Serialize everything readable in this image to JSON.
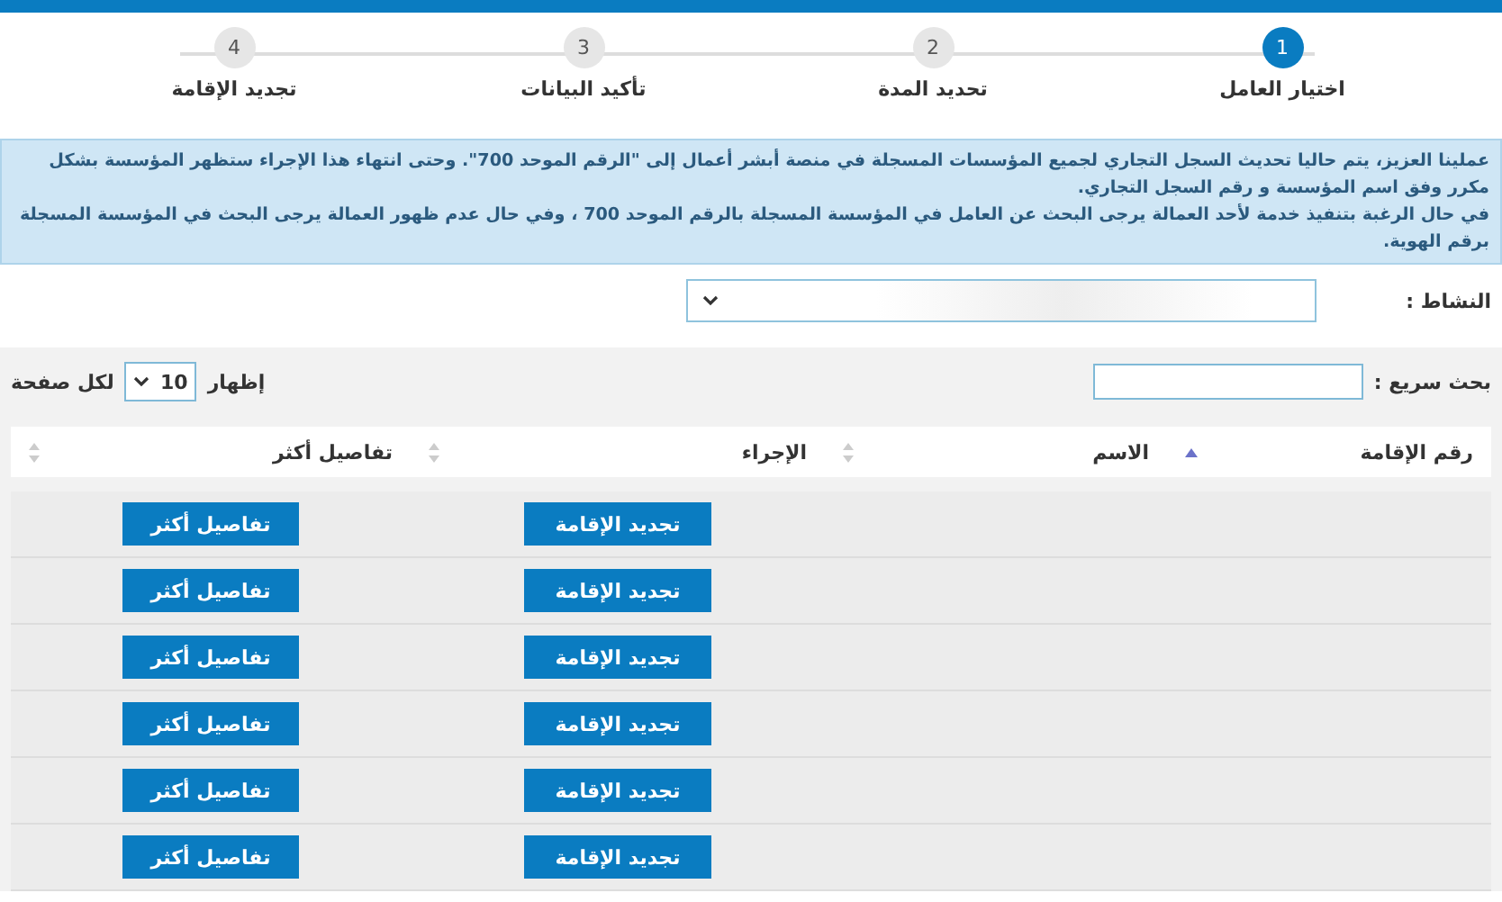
{
  "steps": [
    {
      "number": "1",
      "label": "اختيار العامل",
      "selected": true
    },
    {
      "number": "2",
      "label": "تحديد المدة",
      "selected": false
    },
    {
      "number": "3",
      "label": "تأكيد البيانات",
      "selected": false
    },
    {
      "number": "4",
      "label": "تجديد الإقامة",
      "selected": false
    }
  ],
  "notice": [
    "عملينا العزيز، يتم حاليا تحديث السجل التجاري لجميع المؤسسات المسجلة في منصة أبشر أعمال إلى \"الرقم الموحد 700\". وحتى انتهاء هذا الإجراء ستظهر المؤسسة بشكل مكرر وفق اسم المؤسسة و رقم السجل التجاري.",
    "في حال الرغبة بتنفيذ خدمة لأحد العمالة يرجى البحث عن العامل في المؤسسة المسجلة بالرقم الموحد 700 ، وفي حال عدم ظهور العمالة يرجى البحث في المؤسسة المسجلة برقم الهوية."
  ],
  "activity": {
    "label": "النشاط :"
  },
  "search": {
    "label": "بحث سريع :"
  },
  "page_size": {
    "show_label": "إظهار",
    "value": "10",
    "per_page_label": "لكل صفحة"
  },
  "table": {
    "columns": [
      {
        "label": "رقم الإقامة",
        "sorted": true
      },
      {
        "label": "الاسم",
        "sorted": false
      },
      {
        "label": "الإجراء",
        "sorted": false
      },
      {
        "label": "تفاصيل أكثر",
        "sorted": false
      }
    ],
    "rows": [
      {
        "action": "تجديد الإقامة",
        "details": "تفاصيل أكثر"
      },
      {
        "action": "تجديد الإقامة",
        "details": "تفاصيل أكثر"
      },
      {
        "action": "تجديد الإقامة",
        "details": "تفاصيل أكثر"
      },
      {
        "action": "تجديد الإقامة",
        "details": "تفاصيل أكثر"
      },
      {
        "action": "تجديد الإقامة",
        "details": "تفاصيل أكثر"
      },
      {
        "action": "تجديد الإقامة",
        "details": "تفاصيل أكثر"
      }
    ]
  }
}
